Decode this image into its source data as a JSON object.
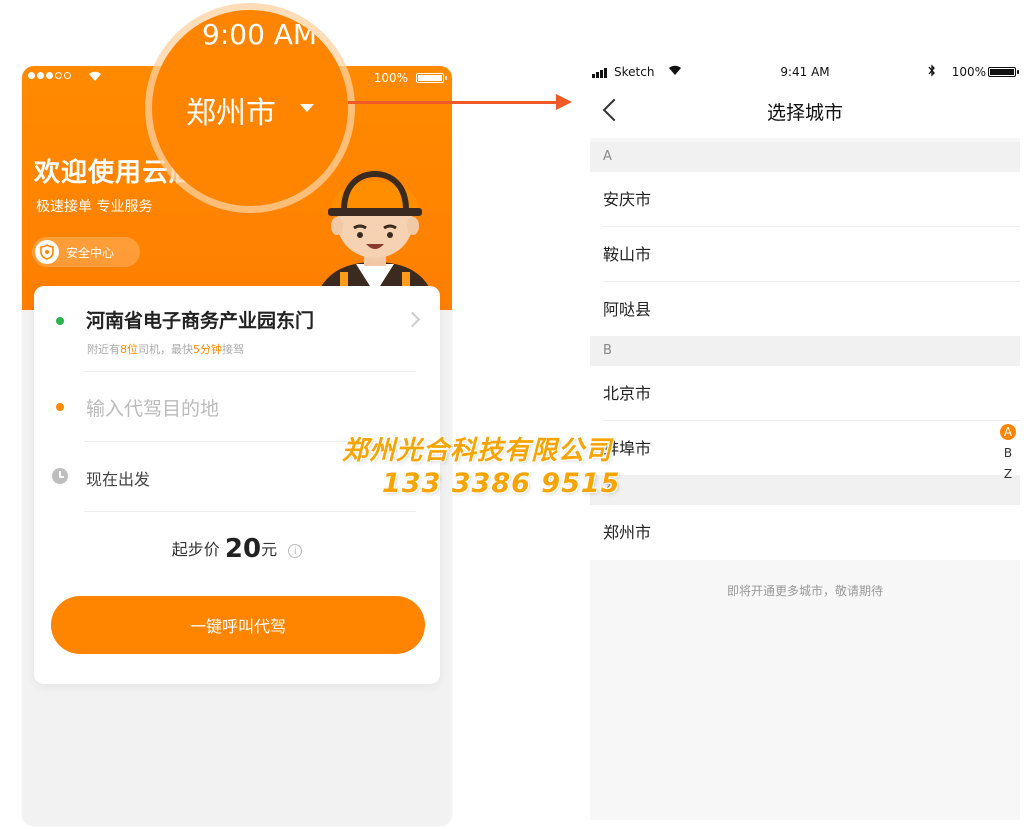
{
  "colors": {
    "brand_orange": "#ff8500",
    "arrow": "#f05a28",
    "green_dot": "#2bb24c",
    "watermark": "#f6a400"
  },
  "left_phone": {
    "status_bar": {
      "battery_text": "100%"
    },
    "magnifier": {
      "time": "9:00 AM",
      "city": "郑州市"
    },
    "welcome_title": "欢迎使用云店",
    "tagline": "极速接单  专业服务",
    "safety_center": "安全中心",
    "pickup": {
      "title": "河南省电子商务产业园东门",
      "sub_prefix": "附近有",
      "driver_count": "8位",
      "sub_mid": "司机，最快",
      "eta": "5分钟",
      "sub_suffix": "接驾"
    },
    "destination_placeholder": "输入代驾目的地",
    "departure": "现在出发",
    "price": {
      "prefix": "起步价",
      "amount": "20",
      "unit": "元",
      "info_glyph": "i"
    },
    "call_button": "一键呼叫代驾"
  },
  "right_phone": {
    "status_bar": {
      "carrier": "Sketch",
      "time": "9:41 AM",
      "battery_text": "100%"
    },
    "nav_title": "选择城市",
    "sections": [
      {
        "letter": "A",
        "cities": [
          "安庆市",
          "鞍山市",
          "阿哒县"
        ]
      },
      {
        "letter": "B",
        "cities": [
          "北京市",
          "蚌埠市"
        ]
      },
      {
        "letter": "Z",
        "cities": [
          "郑州市"
        ]
      }
    ],
    "footer_note": "即将开通更多城市，敬请期待",
    "index_letters": [
      "A",
      "B",
      "Z"
    ],
    "active_index": "A"
  },
  "watermark": {
    "company": "郑州光合科技有限公司",
    "phone": "133 3386 9515"
  }
}
